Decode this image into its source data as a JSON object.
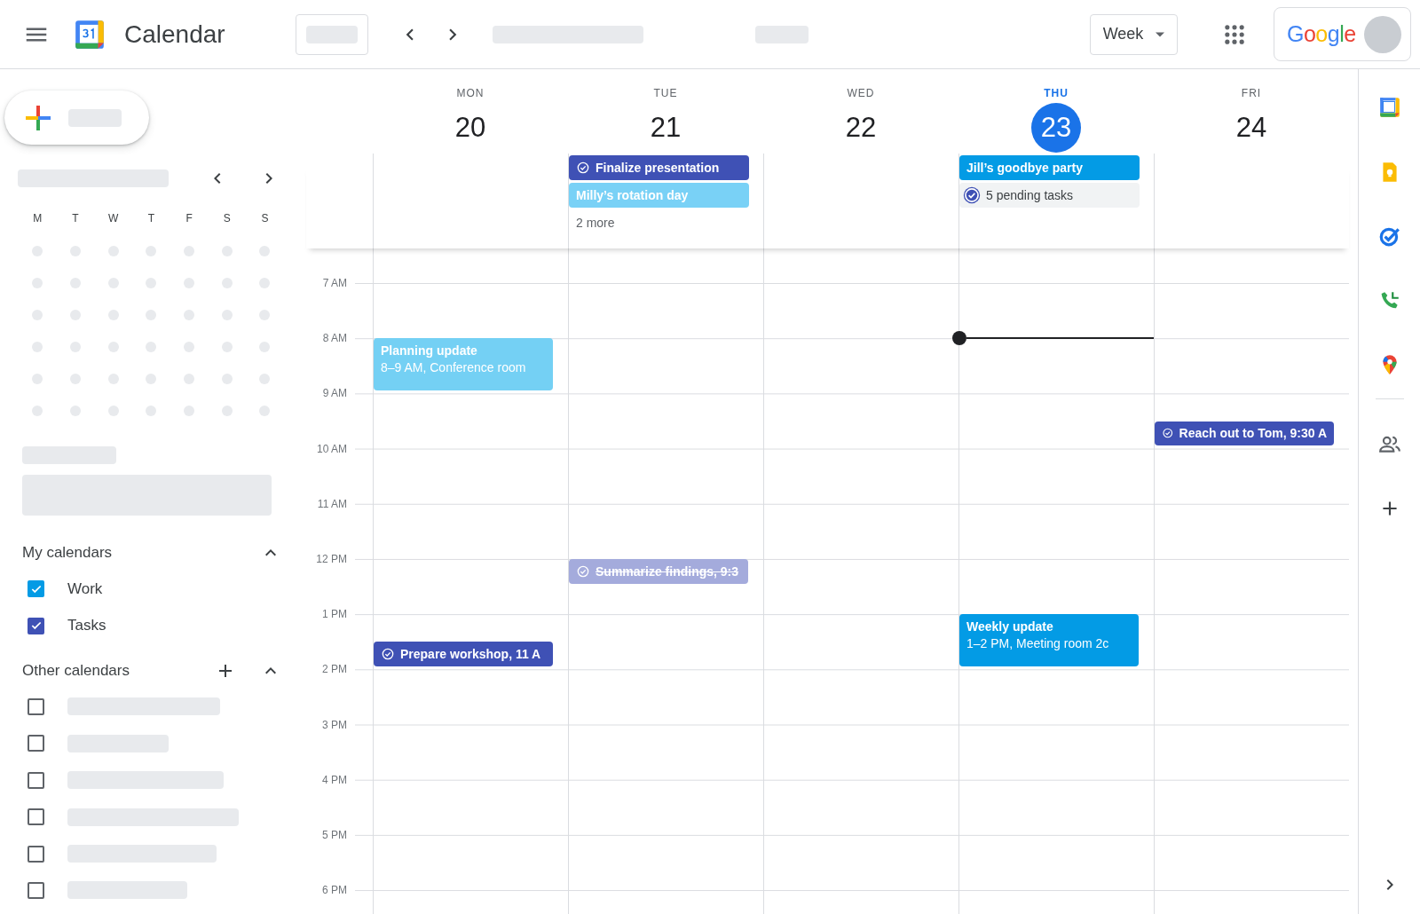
{
  "header": {
    "app_name": "Calendar",
    "view": "Week",
    "account_brand": "Google"
  },
  "mini_calendar": {
    "weekdays": [
      "M",
      "T",
      "W",
      "T",
      "F",
      "S",
      "S"
    ]
  },
  "my_calendars": {
    "title": "My calendars",
    "expanded": true,
    "items": [
      {
        "label": "Work",
        "checked": true,
        "color": "#039be5"
      },
      {
        "label": "Tasks",
        "checked": true,
        "color": "#3f51b5"
      }
    ]
  },
  "other_calendars": {
    "title": "Other calendars",
    "expanded": true,
    "items": [
      {
        "checked": false
      },
      {
        "checked": false
      },
      {
        "checked": false
      },
      {
        "checked": false
      },
      {
        "checked": false
      },
      {
        "checked": false
      }
    ]
  },
  "days": [
    {
      "weekday": "MON",
      "date": "20",
      "today": false,
      "events": [
        {
          "kind": "event",
          "title": "Planning update",
          "detail": "8–9 AM, Conference room",
          "color": "#74d0f4",
          "done": false
        },
        {
          "kind": "task",
          "title": "Prepare workshop, 11 A",
          "color": "#3f51b5",
          "done": false
        }
      ]
    },
    {
      "weekday": "TUE",
      "date": "21",
      "today": false,
      "all_day": [
        {
          "kind": "task",
          "title": "Finalize presentation",
          "color": "#3f51b5",
          "done": false
        },
        {
          "kind": "event",
          "title": "Milly’s rotation day",
          "color": "#79d1f6",
          "done": false
        },
        {
          "kind": "more",
          "title": "2 more"
        }
      ],
      "events": [
        {
          "kind": "task",
          "title": "Summarize findings, 9:3",
          "color": "#a4abdc",
          "done": true
        }
      ]
    },
    {
      "weekday": "WED",
      "date": "22",
      "today": false
    },
    {
      "weekday": "THU",
      "date": "23",
      "today": true,
      "all_day": [
        {
          "kind": "event",
          "title": "Jill’s goodbye party",
          "color": "#039be5",
          "done": false
        },
        {
          "kind": "task-summary",
          "title": "5 pending tasks"
        }
      ],
      "events": [
        {
          "kind": "event",
          "title": "Weekly update",
          "detail": "1–2 PM, Meeting room 2c",
          "color": "#039be5",
          "done": false
        }
      ]
    },
    {
      "weekday": "FRI",
      "date": "24",
      "today": false,
      "events": [
        {
          "kind": "task",
          "title": "Reach out to Tom, 9:30 A",
          "color": "#3f51b5",
          "done": false
        }
      ]
    }
  ],
  "time_labels": [
    "7 AM",
    "8 AM",
    "9 AM",
    "10 AM",
    "11 AM",
    "12 PM",
    "1 PM",
    "2 PM",
    "3 PM",
    "4 PM",
    "5 PM",
    "6 PM"
  ]
}
